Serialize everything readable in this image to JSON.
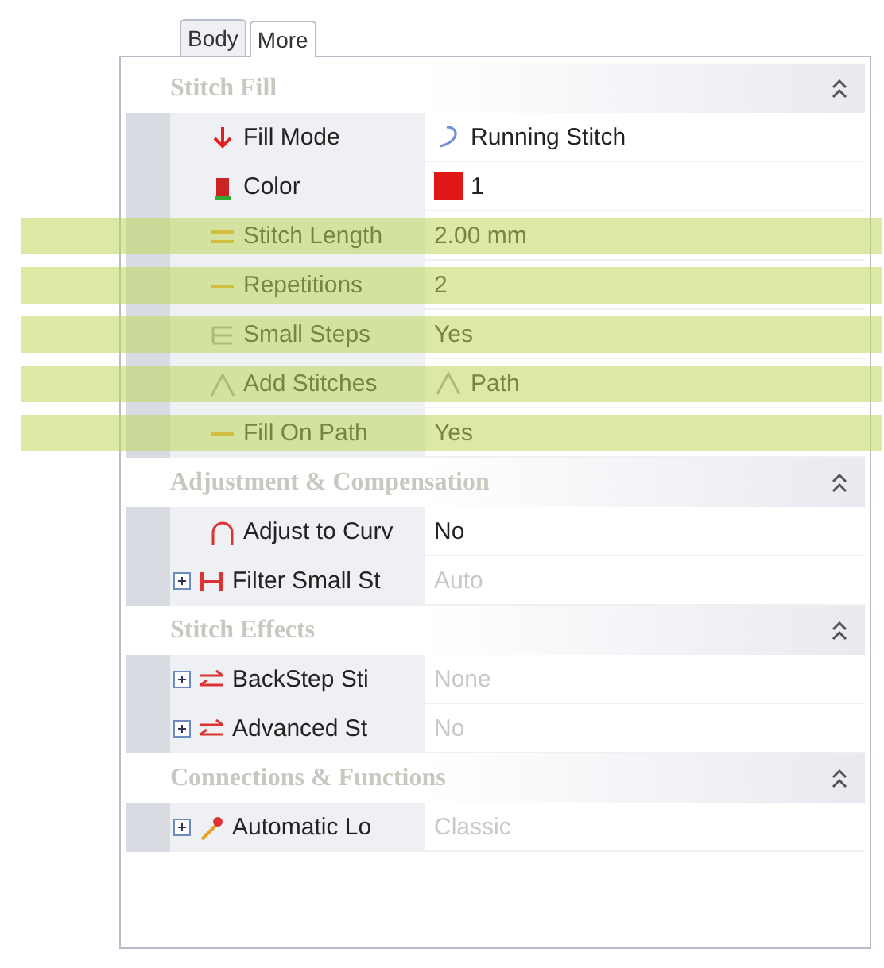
{
  "tabs": [
    {
      "label": "Body",
      "selected": false
    },
    {
      "label": "More",
      "selected": true
    }
  ],
  "sections": [
    {
      "title": "Stitch Fill",
      "expanded": true,
      "rows": [
        {
          "kind": "down-arrow",
          "label": "Fill Mode",
          "value": {
            "text": "Running Stitch",
            "kind": "curve"
          },
          "expandable": false,
          "disabled": false,
          "highlighted": false
        },
        {
          "kind": "spool",
          "label": "Color",
          "value": {
            "text": "1",
            "kind": "swatch",
            "color": "#e01818"
          },
          "expandable": false,
          "disabled": false,
          "highlighted": false
        },
        {
          "kind": "double-line",
          "label": "Stitch Length",
          "value": {
            "text": "2.00 mm",
            "kind": "plain"
          },
          "expandable": false,
          "disabled": false,
          "highlighted": true
        },
        {
          "kind": "dash",
          "label": "Repetitions",
          "value": {
            "text": "2",
            "kind": "plain"
          },
          "expandable": false,
          "disabled": false,
          "highlighted": true
        },
        {
          "kind": "steps",
          "label": "Small Steps",
          "value": {
            "text": "Yes",
            "kind": "plain"
          },
          "expandable": false,
          "disabled": false,
          "highlighted": true
        },
        {
          "kind": "peak",
          "label": "Add Stitches",
          "value": {
            "text": "Path",
            "kind": "peak"
          },
          "expandable": false,
          "disabled": false,
          "highlighted": true
        },
        {
          "kind": "dash",
          "label": "Fill On Path",
          "value": {
            "text": "Yes",
            "kind": "plain"
          },
          "expandable": false,
          "disabled": false,
          "highlighted": true
        }
      ]
    },
    {
      "title": "Adjustment & Compensation",
      "expanded": true,
      "rows": [
        {
          "kind": "arch",
          "label": "Adjust to Curv",
          "value": {
            "text": "No",
            "kind": "plain"
          },
          "expandable": false,
          "disabled": false,
          "highlighted": false
        },
        {
          "kind": "filter",
          "label": "Filter Small St",
          "value": {
            "text": "Auto",
            "kind": "plain"
          },
          "expandable": true,
          "disabled": true,
          "highlighted": false
        }
      ]
    },
    {
      "title": "Stitch Effects",
      "expanded": true,
      "rows": [
        {
          "kind": "arrows",
          "label": "BackStep Sti",
          "value": {
            "text": "None",
            "kind": "plain"
          },
          "expandable": true,
          "disabled": true,
          "highlighted": false
        },
        {
          "kind": "arrows",
          "label": "Advanced St",
          "value": {
            "text": "No",
            "kind": "plain"
          },
          "expandable": true,
          "disabled": true,
          "highlighted": false
        }
      ]
    },
    {
      "title": "Connections & Functions",
      "expanded": true,
      "rows": [
        {
          "kind": "pin",
          "label": "Automatic Lo",
          "value": {
            "text": "Classic",
            "kind": "plain"
          },
          "expandable": true,
          "disabled": true,
          "highlighted": false
        }
      ]
    }
  ]
}
